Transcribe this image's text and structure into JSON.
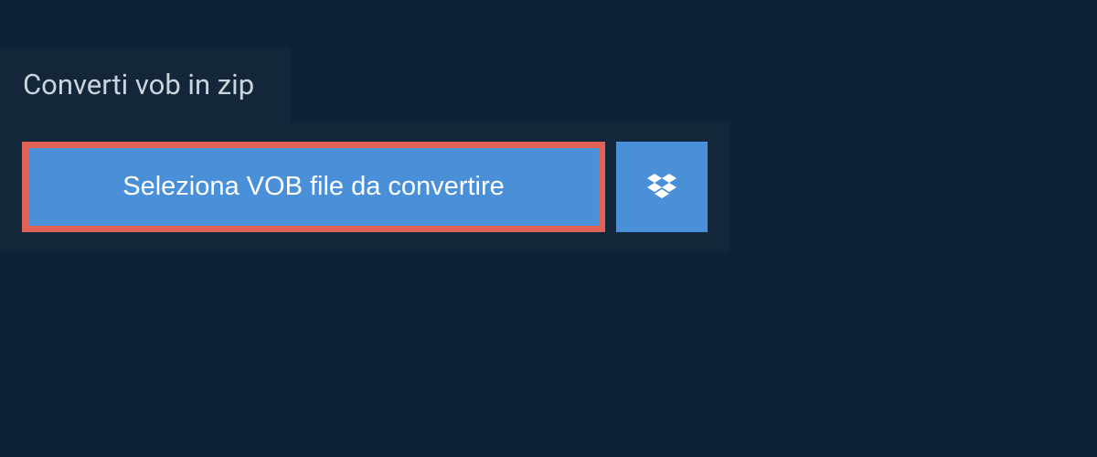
{
  "header": {
    "title": "Converti vob in zip"
  },
  "upload": {
    "select_button_label": "Seleziona VOB file da convertire"
  },
  "colors": {
    "background": "#0b2239",
    "panel": "#13263a",
    "button_primary": "#4a90d9",
    "button_highlight_border": "#e06256",
    "text_light": "#cdd5dc",
    "text_white": "#ffffff"
  }
}
